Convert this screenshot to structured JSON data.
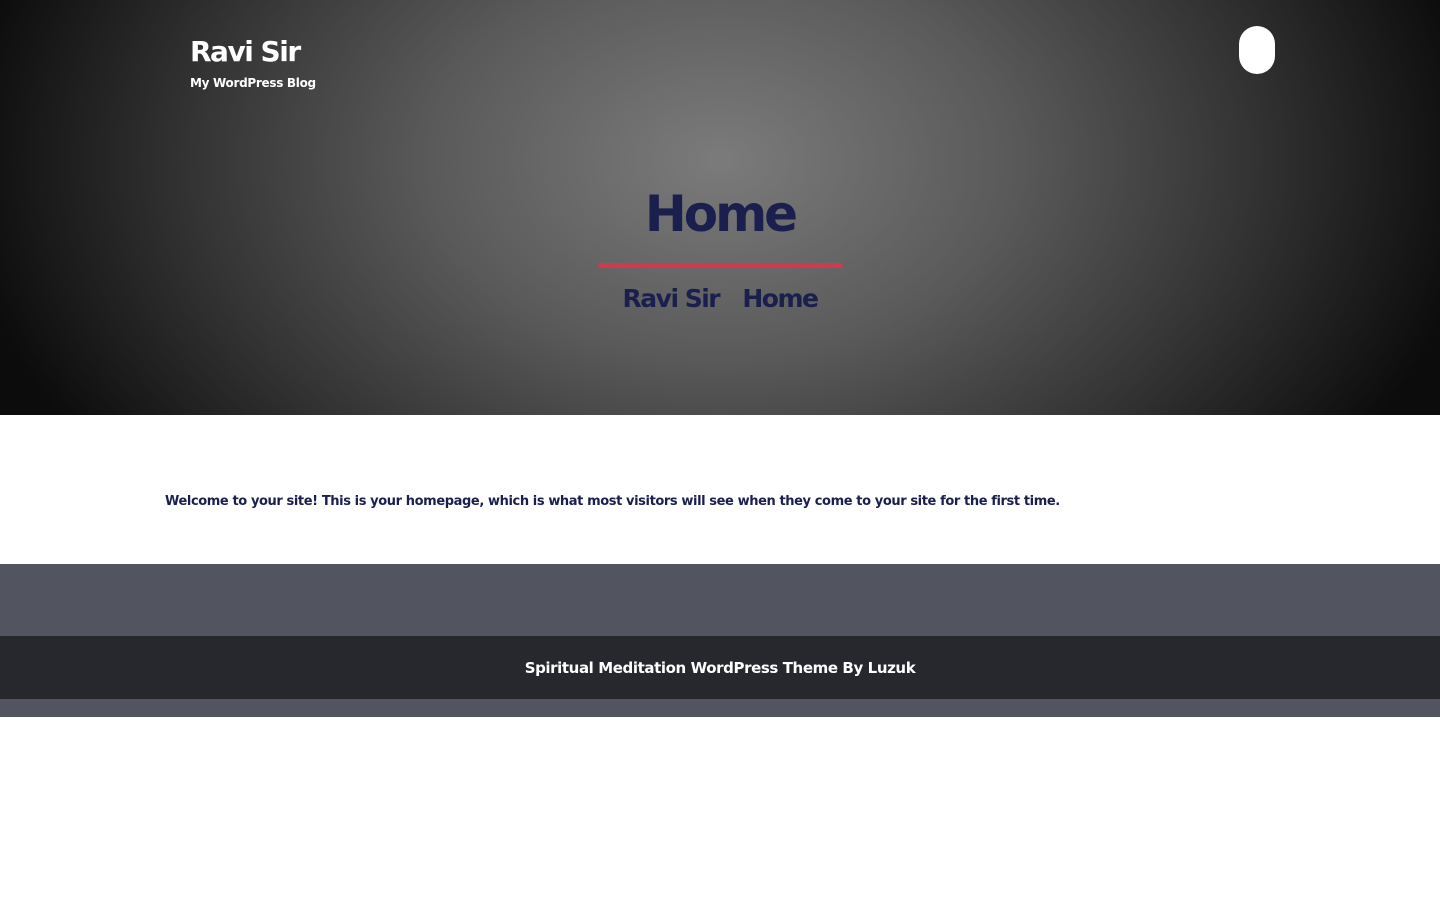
{
  "header": {
    "site_title": "Ravi Sir",
    "site_description": "My WordPress Blog",
    "menu_toggle_icon": "menu-toggle-icon"
  },
  "page_header": {
    "title": "Home",
    "breadcrumb": [
      "Ravi Sir",
      "Home"
    ]
  },
  "content": {
    "text": "Welcome to your site! This is your homepage, which is what most visitors will see when they come to your site for the first time."
  },
  "footer": {
    "credit": "Spiritual Meditation WordPress Theme By Luzuk"
  },
  "colors": {
    "title_text": "#1a1f4e",
    "accent_underline": "#d1394e",
    "footer_bg": "#52545f",
    "footer_bar_bg": "#27282e"
  }
}
